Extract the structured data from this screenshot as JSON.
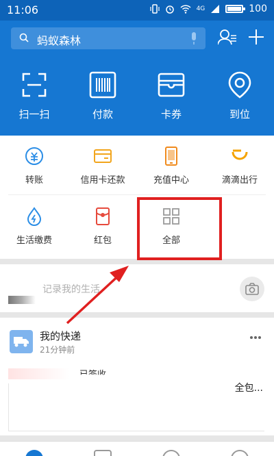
{
  "status_bar": {
    "time": "11:06",
    "network": "4G",
    "battery": "100",
    "battery_level": 1.0
  },
  "header": {
    "search": {
      "text": "蚂蚁森林",
      "icon": "search-icon",
      "mic_icon": "mic-icon"
    },
    "contacts_icon": "contacts-icon",
    "add_icon": "plus-icon",
    "quick_actions": [
      {
        "label": "扫一扫",
        "icon": "scan-icon"
      },
      {
        "label": "付款",
        "icon": "barcode-icon"
      },
      {
        "label": "卡券",
        "icon": "wallet-icon"
      },
      {
        "label": "到位",
        "icon": "location-icon"
      }
    ]
  },
  "services": [
    {
      "label": "转账",
      "icon": "transfer-icon",
      "color": "#2a8de6"
    },
    {
      "label": "信用卡还款",
      "icon": "credit-card-icon",
      "color": "#f2a51c"
    },
    {
      "label": "充值中心",
      "icon": "phone-icon",
      "color": "#f08a1c"
    },
    {
      "label": "滴滴出行",
      "icon": "didi-icon",
      "color": "#f5a300"
    },
    {
      "label": "生活缴费",
      "icon": "water-drop-icon",
      "color": "#2a8de6"
    },
    {
      "label": "红包",
      "icon": "red-envelope-icon",
      "color": "#e64a3c"
    },
    {
      "label": "全部",
      "icon": "grid-icon",
      "color": "#9a9a9a"
    }
  ],
  "feed": {
    "prompt": "记录我的生活",
    "camera_icon": "camera-icon"
  },
  "card": {
    "title": "我的快递",
    "time": "21分钟前",
    "status": "已签收",
    "body": "全包...",
    "icon": "truck-icon",
    "more_icon": "more-icon"
  },
  "colors": {
    "header_blue": "#1677d2",
    "status_blue": "#0d63b8",
    "highlight_red": "#e02020"
  }
}
